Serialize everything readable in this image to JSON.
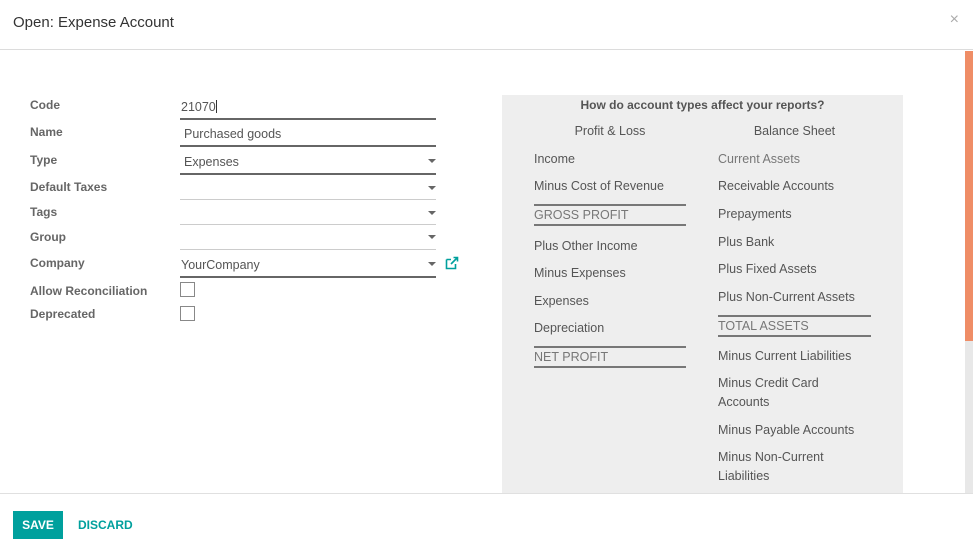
{
  "dialog": {
    "title": "Open: Expense Account",
    "close_label": "×"
  },
  "form": {
    "code": {
      "label": "Code",
      "value": "21070"
    },
    "name": {
      "label": "Name",
      "value": "Purchased goods"
    },
    "type": {
      "label": "Type",
      "value": "Expenses"
    },
    "default_taxes": {
      "label": "Default Taxes",
      "value": ""
    },
    "tags": {
      "label": "Tags",
      "value": ""
    },
    "group": {
      "label": "Group",
      "value": ""
    },
    "company": {
      "label": "Company",
      "value": "YourCompany"
    },
    "allow_reconciliation": {
      "label": "Allow Reconciliation",
      "checked": false
    },
    "deprecated": {
      "label": "Deprecated",
      "checked": false
    }
  },
  "help_panel": {
    "title": "How do account types affect your reports?",
    "profit_loss": {
      "heading": "Profit & Loss",
      "items": [
        "Income",
        "Minus Cost of Revenue",
        "GROSS PROFIT",
        "Plus Other Income",
        "Minus Expenses",
        "Expenses",
        "Depreciation",
        "NET PROFIT"
      ]
    },
    "balance_sheet": {
      "heading": "Balance Sheet",
      "items": [
        "Current Assets",
        "Receivable Accounts",
        "Prepayments",
        "Plus Bank",
        "Plus Fixed Assets",
        "Plus Non-Current Assets",
        "TOTAL ASSETS",
        "Minus Current Liabilities",
        "Minus Credit Card Accounts",
        "Minus Payable Accounts",
        "Minus Non-Current Liabilities"
      ]
    }
  },
  "footer": {
    "save_label": "SAVE",
    "discard_label": "DISCARD"
  },
  "colors": {
    "primary": "#00A09D",
    "scroll_thumb": "#EF8D66",
    "panel_bg": "#EEEEEE"
  }
}
